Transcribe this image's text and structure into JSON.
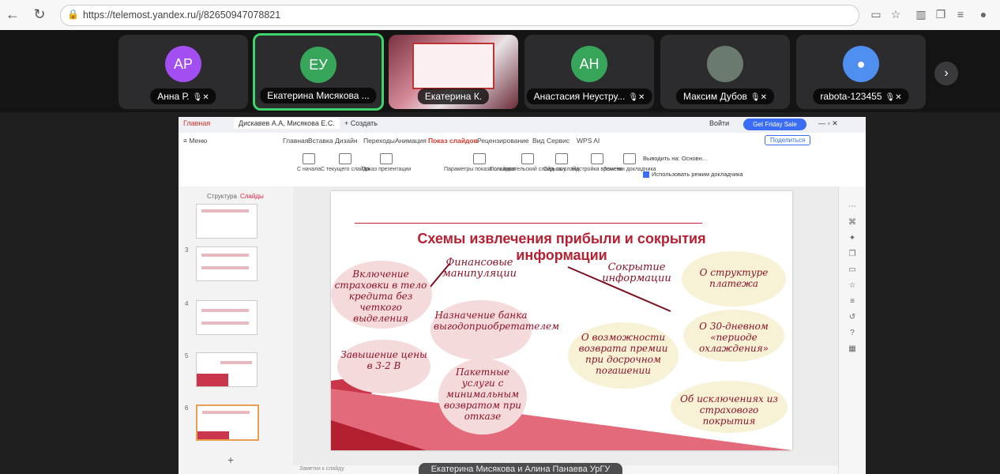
{
  "browser": {
    "url": "https://telemost.yandex.ru/j/82650947078821",
    "icons": [
      "back-icon",
      "reload-icon",
      "lock-icon",
      "pip-icon",
      "star-icon",
      "sidebar-icon",
      "collections-icon",
      "favorites-icon"
    ]
  },
  "participants": [
    {
      "initials": "АР",
      "name": "Анна Р.",
      "color": "#a34ef0",
      "muted": true
    },
    {
      "initials": "ЕУ",
      "name": "Екатерина Мисякова ...",
      "color": "#37a65b",
      "muted": false,
      "active": true
    },
    {
      "initials": "",
      "name": "Екатерина К.",
      "video": true,
      "muted": false
    },
    {
      "initials": "АН",
      "name": "Анастасия Неустру...",
      "color": "#37a65b",
      "muted": true
    },
    {
      "initials": "",
      "name": "Максим Дубов",
      "photo": true,
      "muted": true
    },
    {
      "initials": "",
      "name": "rabota-123455",
      "color": "#4f8ff0",
      "muted": true,
      "default_avatar": true
    }
  ],
  "wps": {
    "tabs": {
      "home": "Главная",
      "doc": "Дискавев А.А, Мисякова Е.С.",
      "new": "+ Создать",
      "login_btn": "Войти",
      "go_btn": "Get Friday Sale"
    },
    "menu": [
      "≡ Меню",
      "Главная",
      "Вставка",
      "Дизайн",
      "Переходы",
      "Анимация",
      "Показ слайдов",
      "Рецензирование",
      "Вид",
      "Сервис",
      "WPS AI"
    ],
    "active_menu": "Показ слайдов",
    "share": "Поделиться",
    "ribbon": [
      "С начала",
      "С текущего слайда",
      "Показ презентации",
      "Параметры показа слайдов",
      "Пользовательский слайд-шоу",
      "Скрыть слайд",
      "Настройка времени",
      "Заметки докладчика"
    ],
    "ribbon_select": "Выводить на: Основн...",
    "ribbon_check": "Использовать режим докладчика",
    "thumb_tabs": {
      "outline": "Структура",
      "slides": "Слайды"
    },
    "thumb_numbers": [
      "3",
      "4",
      "5",
      "6"
    ],
    "notes_placeholder": "Заметки к слайду"
  },
  "slide": {
    "title_line1": "Схемы извлечения прибыли и сокрытия",
    "title_line2": "информации",
    "left_heading": "Финансовые манипуляции",
    "right_heading": "Сокрытие информации",
    "items_left": [
      "Включение страховки в тело кредита без четкого выделения",
      "Назначение банка выгодоприобретателем",
      "Завышение цены в 3-2 В",
      "Пакетные услуги с минимальным возвратом при отказе"
    ],
    "items_right": [
      "О структуре платежа",
      "О 30-дневном «периоде охлаждения»",
      "О возможности возврата премии при досрочном погашении",
      "Об исключениях из страхового покрытия"
    ]
  },
  "caption": "Екатерина Мисякова и Алина Панаева УрГУ"
}
